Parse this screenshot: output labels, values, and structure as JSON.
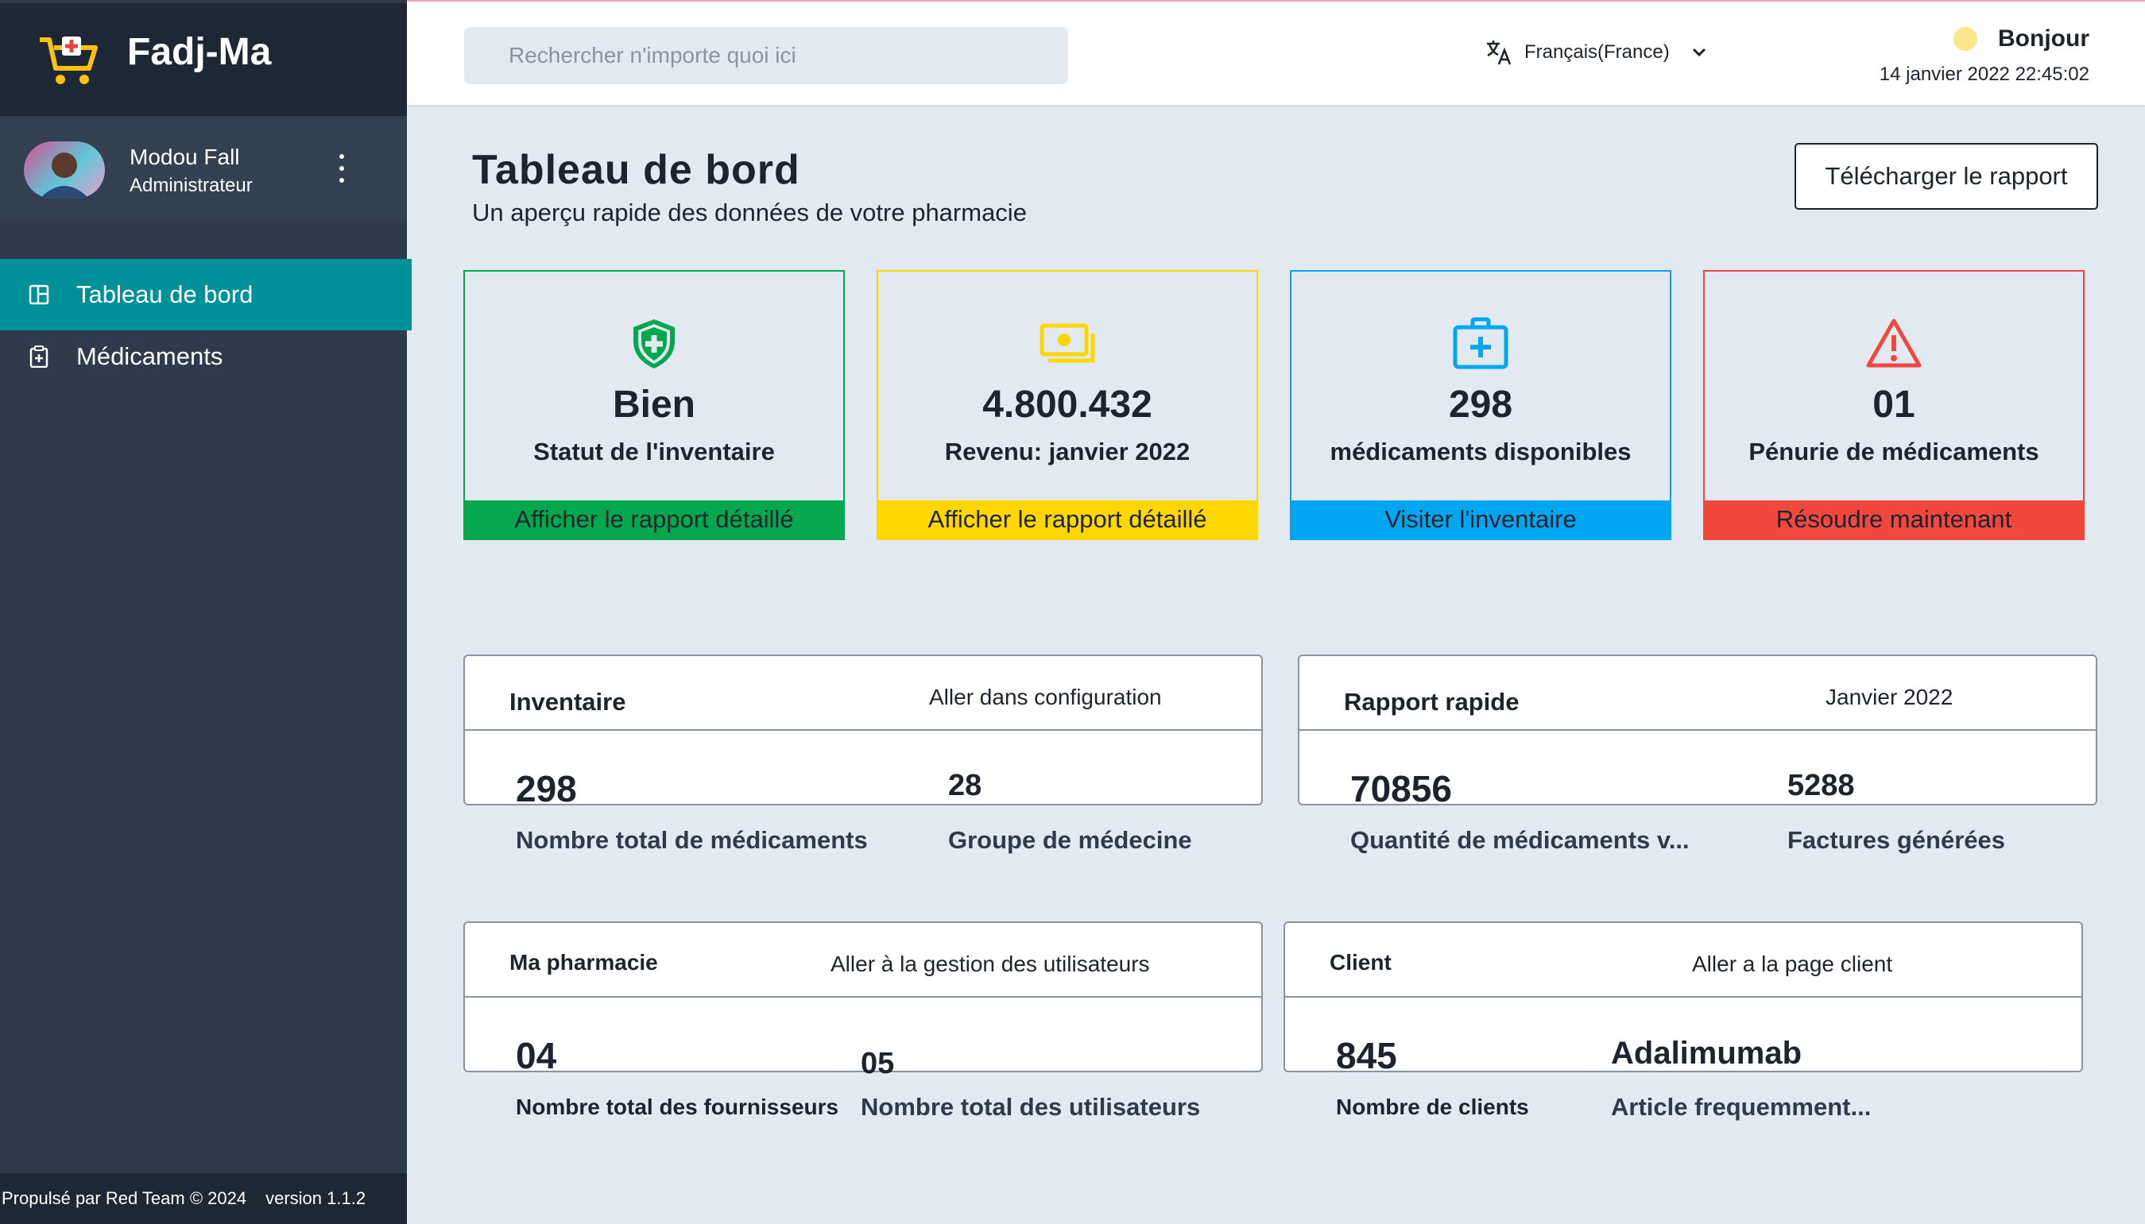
{
  "app": {
    "name": "Fadj-Ma"
  },
  "user": {
    "name": "Modou Fall",
    "role": "Administrateur"
  },
  "nav": {
    "items": [
      {
        "label": "Tableau de bord"
      },
      {
        "label": "Médicaments"
      }
    ]
  },
  "footer": {
    "powered": "Propulsé par Red Team © 2024",
    "version": "version 1.1.2"
  },
  "header": {
    "search_placeholder": "Rechercher n'importe quoi ici",
    "language": "Français(France)",
    "greeting": "Bonjour",
    "datetime": "14 janvier 2022 22:45:02"
  },
  "page": {
    "title": "Tableau de bord",
    "subtitle": "Un aperçu rapide des données de votre pharmacie",
    "download_button": "Télécharger le rapport"
  },
  "stats": [
    {
      "value": "Bien",
      "label": "Statut de l'inventaire",
      "action": "Afficher le rapport détaillé",
      "color": "#03a84e",
      "icon": "shield-plus-icon"
    },
    {
      "value": "4.800.432",
      "label": "Revenu: janvier 2022",
      "action": "Afficher le rapport détaillé",
      "color": "#fed600",
      "icon": "money-icon"
    },
    {
      "value": "298",
      "label": "médicaments disponibles",
      "action": "Visiter l'inventaire",
      "color": "#01a6f0",
      "icon": "medkit-icon"
    },
    {
      "value": "01",
      "label": "Pénurie de médicaments",
      "action": "Résoudre maintenant",
      "color": "#f0483e",
      "icon": "warning-icon"
    }
  ],
  "panels": {
    "inventory": {
      "title": "Inventaire",
      "link": "Aller dans configuration",
      "v1": "298",
      "l1": "Nombre total de médicaments",
      "v2": "28",
      "l2": "Groupe de médecine"
    },
    "quick_report": {
      "title": "Rapport rapide",
      "link": "Janvier 2022",
      "v1": "70856",
      "l1": "Quantité de médicaments v...",
      "v2": "5288",
      "l2": "Factures générées"
    },
    "pharmacy": {
      "title": "Ma pharmacie",
      "link": "Aller à la gestion des utilisateurs",
      "v1": "04",
      "l1": "Nombre total des fournisseurs",
      "v2": "05",
      "l2": "Nombre total des utilisateurs"
    },
    "client": {
      "title": "Client",
      "link": "Aller a la page client",
      "v1": "845",
      "l1": "Nombre de clients",
      "v2": "Adalimumab",
      "l2": "Article frequemment..."
    }
  }
}
